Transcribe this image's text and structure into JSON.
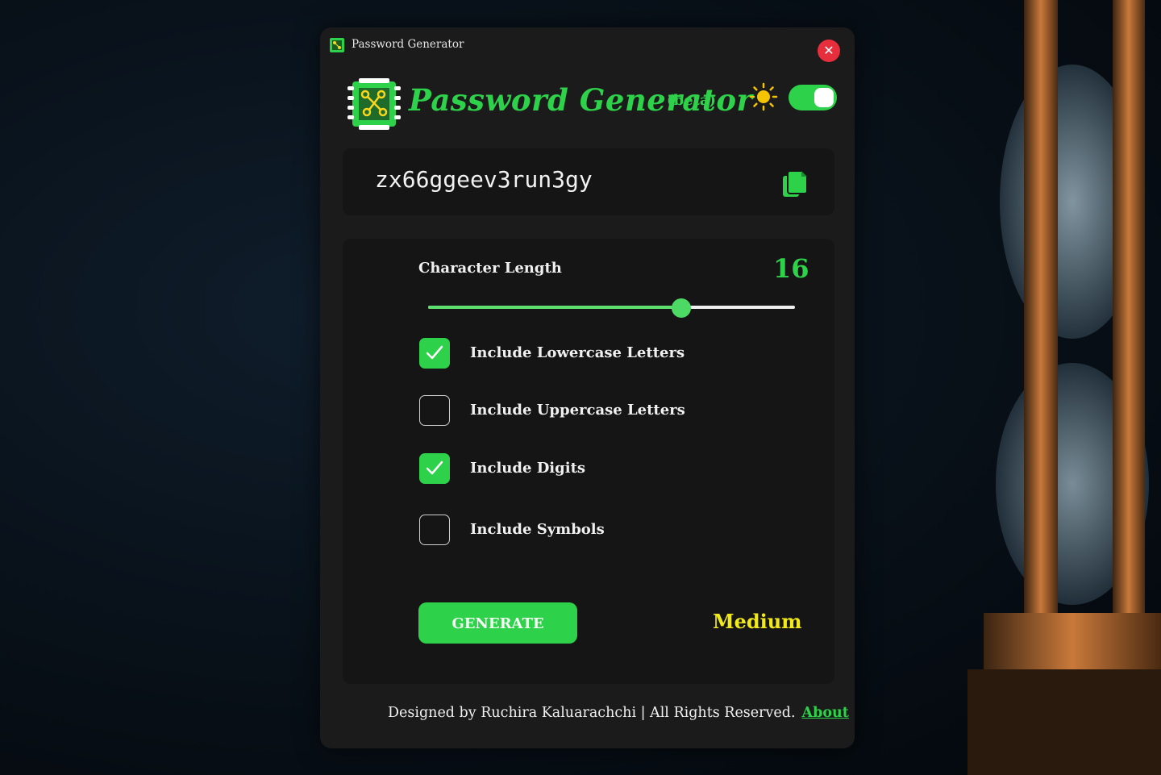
{
  "window": {
    "title": "Password Generator",
    "close_symbol": "✕"
  },
  "header": {
    "title": "Password Generator",
    "badge": "(beta)",
    "theme_icon": "sun-icon",
    "theme_toggle_on": true
  },
  "password": {
    "value": "zx66ggeev3run3gy",
    "copy_icon": "copy-icon"
  },
  "length": {
    "label": "Character Length",
    "value": "16",
    "slider_fraction": 0.69
  },
  "options": [
    {
      "label": "Include Lowercase Letters",
      "checked": true
    },
    {
      "label": "Include Uppercase Letters",
      "checked": false
    },
    {
      "label": "Include Digits",
      "checked": true
    },
    {
      "label": "Include Symbols",
      "checked": false
    }
  ],
  "actions": {
    "generate_label": "GENERATE",
    "strength": "Medium"
  },
  "footer": {
    "text": "Designed by Ruchira Kaluarachchi | All Rights Reserved.",
    "about_link": "About"
  },
  "colors": {
    "accent": "#2ed14a",
    "strength": "#f2ea16",
    "close": "#e62e3c"
  }
}
